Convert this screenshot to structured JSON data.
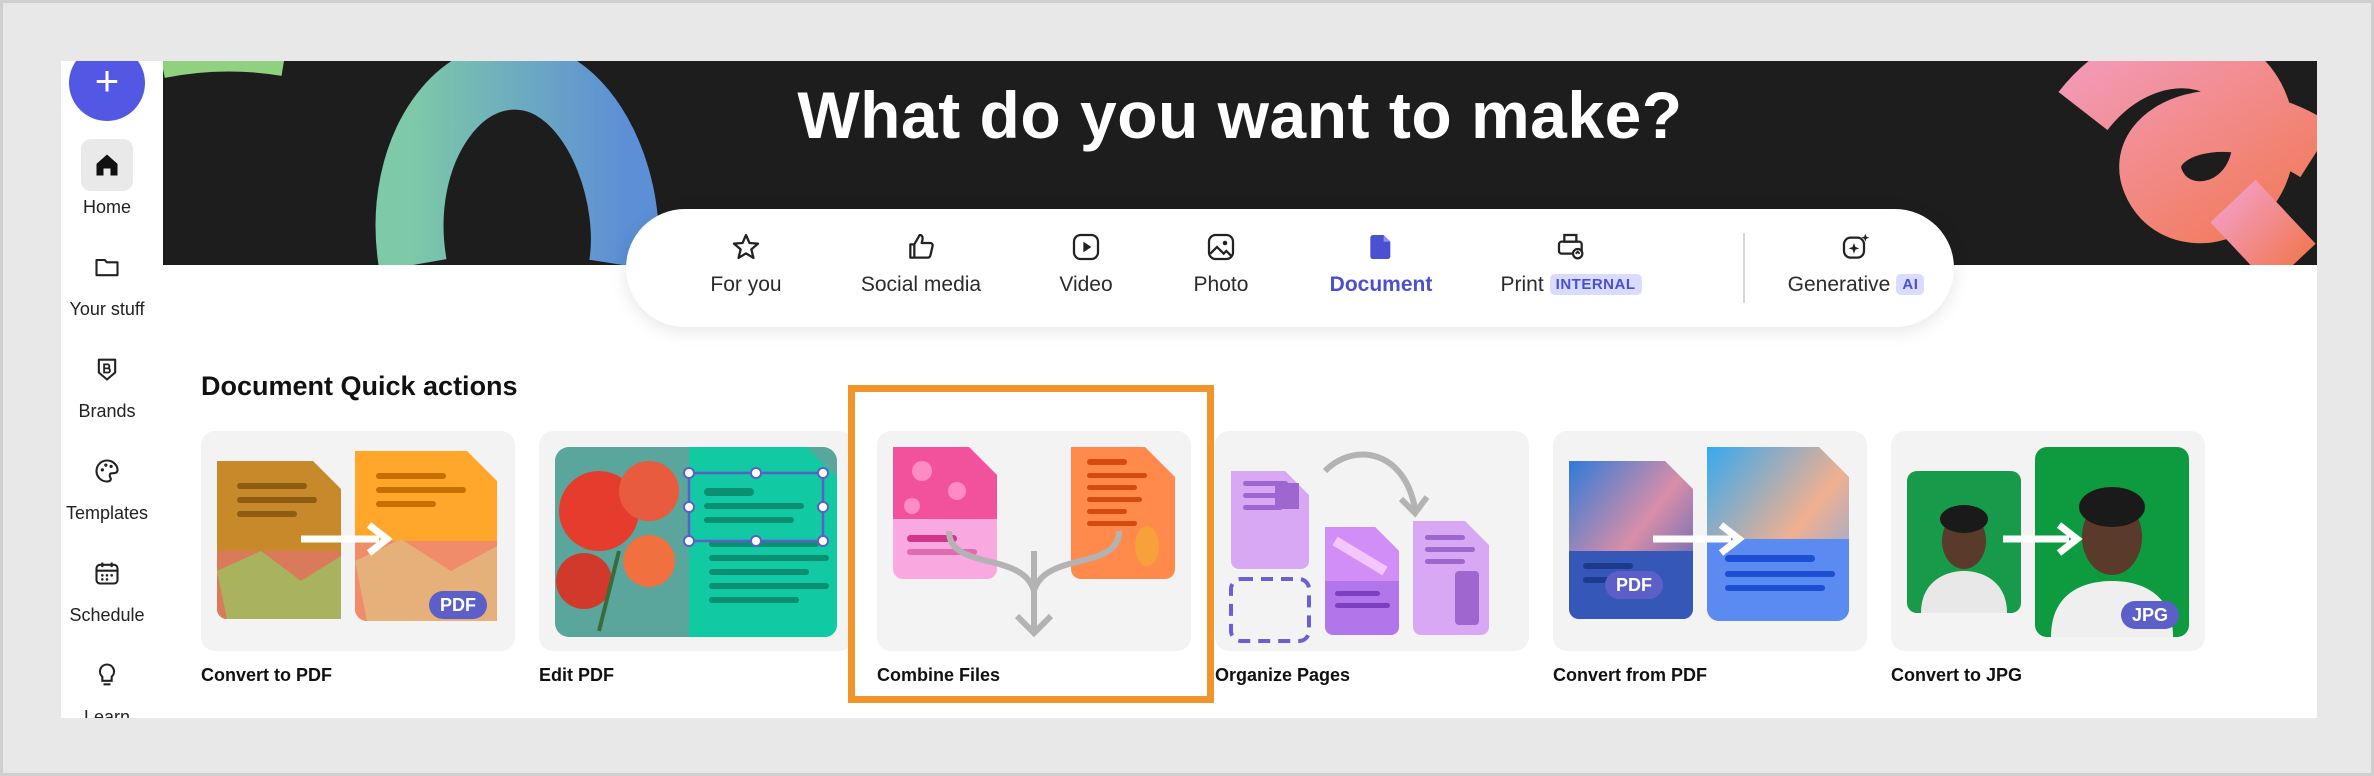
{
  "sidebar": {
    "create_label": "+",
    "items": [
      {
        "label": "Home",
        "icon": "home-icon",
        "active": true
      },
      {
        "label": "Your stuff",
        "icon": "folder-icon"
      },
      {
        "label": "Brands",
        "icon": "brand-icon"
      },
      {
        "label": "Templates",
        "icon": "templates-icon"
      },
      {
        "label": "Schedule",
        "icon": "calendar-icon"
      },
      {
        "label": "Learn",
        "icon": "lightbulb-icon"
      }
    ]
  },
  "hero": {
    "title": "What do you want to make?"
  },
  "tabs": [
    {
      "label": "For you",
      "icon": "star-icon"
    },
    {
      "label": "Social media",
      "icon": "thumbs-up-icon"
    },
    {
      "label": "Video",
      "icon": "play-icon"
    },
    {
      "label": "Photo",
      "icon": "image-icon"
    },
    {
      "label": "Document",
      "icon": "document-icon",
      "active": true
    },
    {
      "label": "Print",
      "icon": "print-icon",
      "tag": "INTERNAL"
    },
    {
      "label": "Generative",
      "icon": "sparkle-icon",
      "tag": "AI"
    }
  ],
  "section": {
    "title": "Document Quick actions"
  },
  "cards": [
    {
      "label": "Convert to PDF",
      "badge": "PDF"
    },
    {
      "label": "Edit PDF"
    },
    {
      "label": "Combine Files",
      "highlighted": true
    },
    {
      "label": "Organize Pages"
    },
    {
      "label": "Convert from PDF",
      "badge": "PDF"
    },
    {
      "label": "Convert to JPG",
      "badge": "JPG"
    }
  ],
  "colors": {
    "accent": "#5258e4",
    "highlight": "#f0952a",
    "hero_bg": "#1d1d1d"
  }
}
